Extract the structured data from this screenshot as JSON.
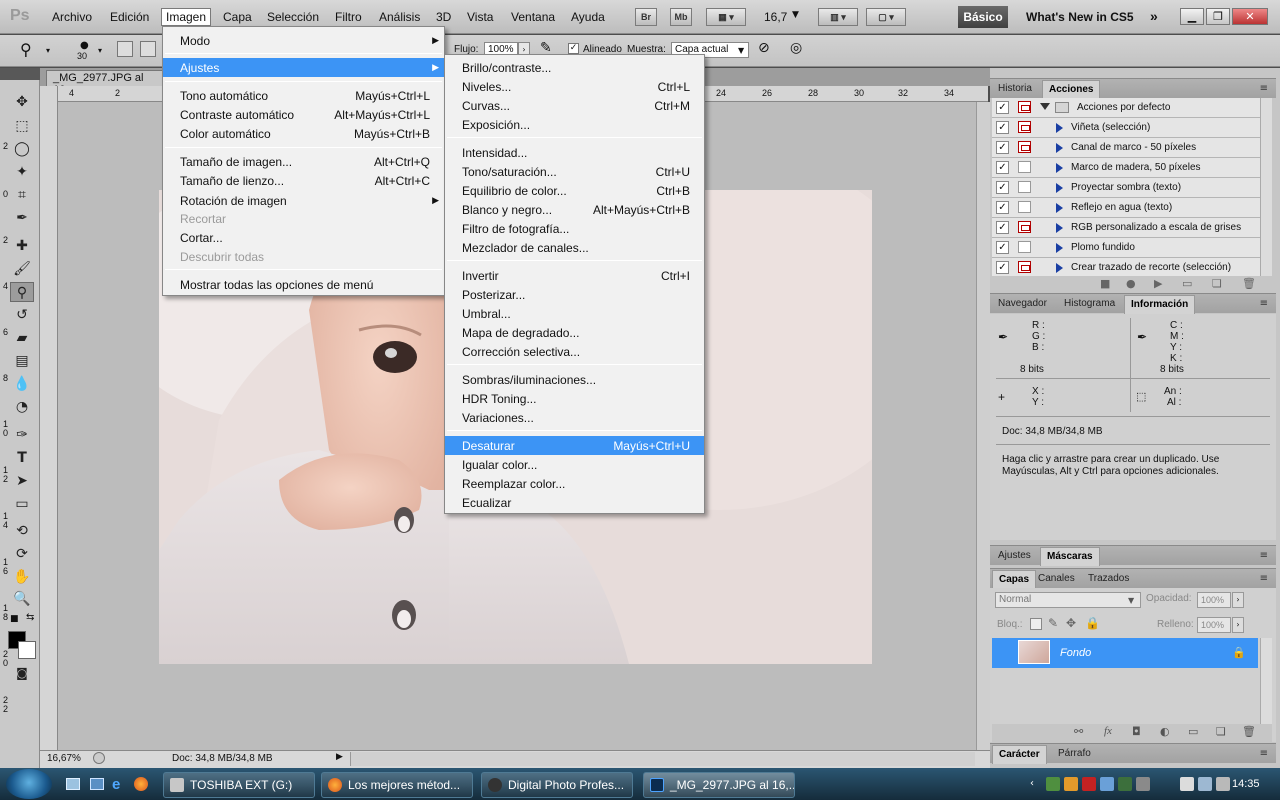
{
  "menubar": {
    "items": [
      "Archivo",
      "Edición",
      "Imagen",
      "Capa",
      "Selección",
      "Filtro",
      "Análisis",
      "3D",
      "Vista",
      "Ventana",
      "Ayuda"
    ],
    "zoom": "16,7",
    "workspace": "Básico",
    "whats_new": "What's New in CS5"
  },
  "options": {
    "brush_size": "30",
    "flujo_label": "Flujo:",
    "flujo_value": "100%",
    "alineado_label": "Alineado",
    "muestra_label": "Muestra:",
    "muestra_value": "Capa actual"
  },
  "document": {
    "tab_title": "_MG_2977.JPG al 16,",
    "zoom_status": "16,67%",
    "doc_status": "Doc: 34,8 MB/34,8 MB"
  },
  "ruler": {
    "top": [
      "4",
      "2",
      "24",
      "26",
      "28",
      "30",
      "32",
      "34"
    ],
    "left": [
      "2",
      "0",
      "2",
      "4",
      "6",
      "8",
      "10",
      "12",
      "14",
      "16",
      "18",
      "20",
      "22"
    ]
  },
  "imagen_menu": {
    "items": [
      {
        "label": "Modo",
        "shortcut": "",
        "submenu": true
      },
      {
        "label": "Ajustes",
        "shortcut": "",
        "submenu": true,
        "highlight": true
      },
      {
        "label": "Tono automático",
        "shortcut": "Mayús+Ctrl+L"
      },
      {
        "label": "Contraste automático",
        "shortcut": "Alt+Mayús+Ctrl+L"
      },
      {
        "label": "Color automático",
        "shortcut": "Mayús+Ctrl+B"
      },
      {
        "label": "Tamaño de imagen...",
        "shortcut": "Alt+Ctrl+Q"
      },
      {
        "label": "Tamaño de lienzo...",
        "shortcut": "Alt+Ctrl+C"
      },
      {
        "label": "Rotación de imagen",
        "shortcut": "",
        "submenu": true
      },
      {
        "label": "Recortar",
        "shortcut": "",
        "disabled": true
      },
      {
        "label": "Cortar...",
        "shortcut": ""
      },
      {
        "label": "Descubrir todas",
        "shortcut": "",
        "disabled": true
      },
      {
        "label": "Mostrar todas las opciones de menú",
        "shortcut": ""
      }
    ]
  },
  "ajustes_menu": {
    "items": [
      {
        "label": "Brillo/contraste...",
        "shortcut": ""
      },
      {
        "label": "Niveles...",
        "shortcut": "Ctrl+L"
      },
      {
        "label": "Curvas...",
        "shortcut": "Ctrl+M"
      },
      {
        "label": "Exposición...",
        "shortcut": ""
      },
      {
        "label": "Intensidad...",
        "shortcut": ""
      },
      {
        "label": "Tono/saturación...",
        "shortcut": "Ctrl+U"
      },
      {
        "label": "Equilibrio de color...",
        "shortcut": "Ctrl+B"
      },
      {
        "label": "Blanco y negro...",
        "shortcut": "Alt+Mayús+Ctrl+B"
      },
      {
        "label": "Filtro de fotografía...",
        "shortcut": ""
      },
      {
        "label": "Mezclador de canales...",
        "shortcut": ""
      },
      {
        "label": "Invertir",
        "shortcut": "Ctrl+I"
      },
      {
        "label": "Posterizar...",
        "shortcut": ""
      },
      {
        "label": "Umbral...",
        "shortcut": ""
      },
      {
        "label": "Mapa de degradado...",
        "shortcut": ""
      },
      {
        "label": "Corrección selectiva...",
        "shortcut": ""
      },
      {
        "label": "Sombras/iluminaciones...",
        "shortcut": ""
      },
      {
        "label": "HDR Toning...",
        "shortcut": ""
      },
      {
        "label": "Variaciones...",
        "shortcut": ""
      },
      {
        "label": "Desaturar",
        "shortcut": "Mayús+Ctrl+U",
        "highlight": true
      },
      {
        "label": "Igualar color...",
        "shortcut": ""
      },
      {
        "label": "Reemplazar color...",
        "shortcut": ""
      },
      {
        "label": "Ecualizar",
        "shortcut": ""
      }
    ]
  },
  "actions_panel": {
    "tabs": [
      "Historia",
      "Acciones"
    ],
    "set_name": "Acciones por defecto",
    "rows": [
      {
        "label": "Viñeta (selección)",
        "dialog": true
      },
      {
        "label": "Canal de marco - 50 píxeles",
        "dialog": true
      },
      {
        "label": "Marco de madera, 50 píxeles",
        "dialog": false
      },
      {
        "label": "Proyectar sombra (texto)",
        "dialog": false
      },
      {
        "label": "Reflejo en agua (texto)",
        "dialog": false
      },
      {
        "label": "RGB personalizado a escala de grises",
        "dialog": true
      },
      {
        "label": "Plomo fundido",
        "dialog": false
      },
      {
        "label": "Crear trazado de recorte (selección)",
        "dialog": true
      }
    ]
  },
  "info_panel": {
    "tabs": [
      "Navegador",
      "Histograma",
      "Información"
    ],
    "rgb_labels": [
      "R :",
      "G :",
      "B :"
    ],
    "cmyk_labels": [
      "C :",
      "M :",
      "Y :",
      "K :"
    ],
    "bits_left": "8 bits",
    "bits_right": "8 bits",
    "xy_labels": [
      "X :",
      "Y :"
    ],
    "size_labels": [
      "An :",
      "Al :"
    ],
    "doc": "Doc: 34,8 MB/34,8 MB",
    "hint": "Haga clic y arrastre para crear un duplicado. Use Mayúsculas, Alt y Ctrl para opciones adicionales."
  },
  "adjust_panel": {
    "tabs": [
      "Ajustes",
      "Máscaras"
    ]
  },
  "layers_panel": {
    "tabs": [
      "Capas",
      "Canales",
      "Trazados"
    ],
    "blend_mode": "Normal",
    "opacity_label": "Opacidad:",
    "opacity_value": "100%",
    "lock_label": "Bloq.:",
    "fill_label": "Relleno:",
    "fill_value": "100%",
    "layer_name": "Fondo"
  },
  "char_panel": {
    "tabs": [
      "Carácter",
      "Párrafo"
    ]
  },
  "taskbar": {
    "tasks": [
      "TOSHIBA EXT (G:)",
      "Los mejores métod...",
      "Digital Photo Profes...",
      "_MG_2977.JPG al 16,..."
    ],
    "clock": "14:35"
  },
  "colors": {
    "highlight": "#3c94f5",
    "foreground": "#000000",
    "background": "#ffffff"
  }
}
